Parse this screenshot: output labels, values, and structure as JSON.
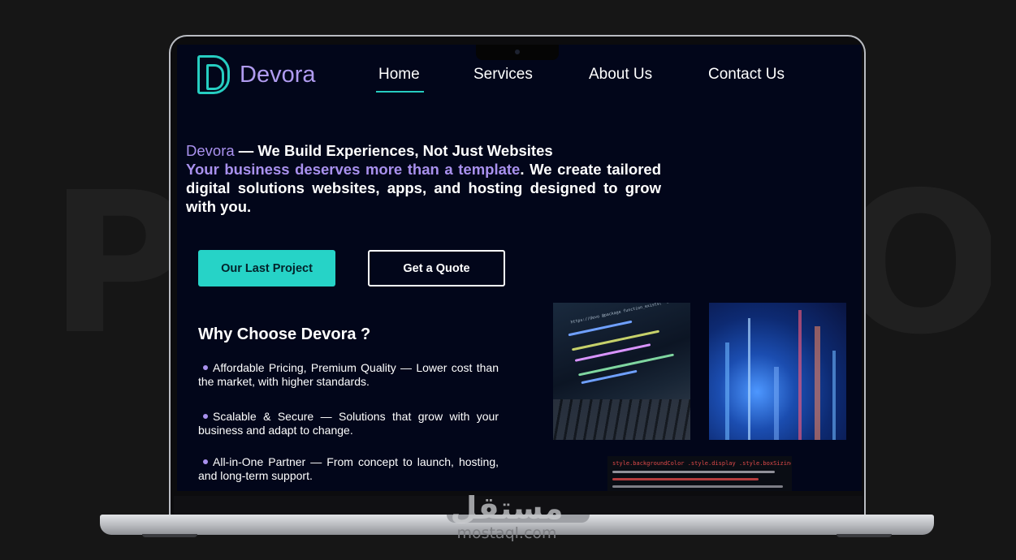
{
  "background": {
    "word": "PORTFOLIO PAGE"
  },
  "nav": {
    "brand": "Devora",
    "items": [
      "Home",
      "Services",
      "About Us",
      "Contact Us"
    ],
    "active": "Home"
  },
  "hero": {
    "brand": "Devora",
    "headline": " — We Build Experiences, Not Just Websites",
    "accent": "Your business deserves more than a template",
    "body": ". We create tailored digital solutions  websites, apps, and hosting designed to grow with you."
  },
  "buttons": {
    "primary": "Our Last Project",
    "secondary": "Get a Quote"
  },
  "why": {
    "title": "Why Choose Devora ?",
    "items": [
      "Affordable Pricing, Premium Quality — Lower cost than the market, with higher standards.",
      "Scalable & Secure — Solutions that grow with your business and adapt to change.",
      "All-in-One Partner — From concept to launch, hosting, and long-term support."
    ]
  },
  "images": {
    "code_snippet": "https://devo  @package  function_exists( 'incode_starter_setup' )",
    "css_snippet": "style.backgroundColor  .style.display  .style.boxSizing  .style.cssText"
  },
  "watermark": {
    "arabic": "مستقل",
    "url": "mostaql.com"
  },
  "colors": {
    "accent_teal": "#26d3c7",
    "accent_purple": "#a991ee",
    "screen_bg": "#02061a"
  }
}
